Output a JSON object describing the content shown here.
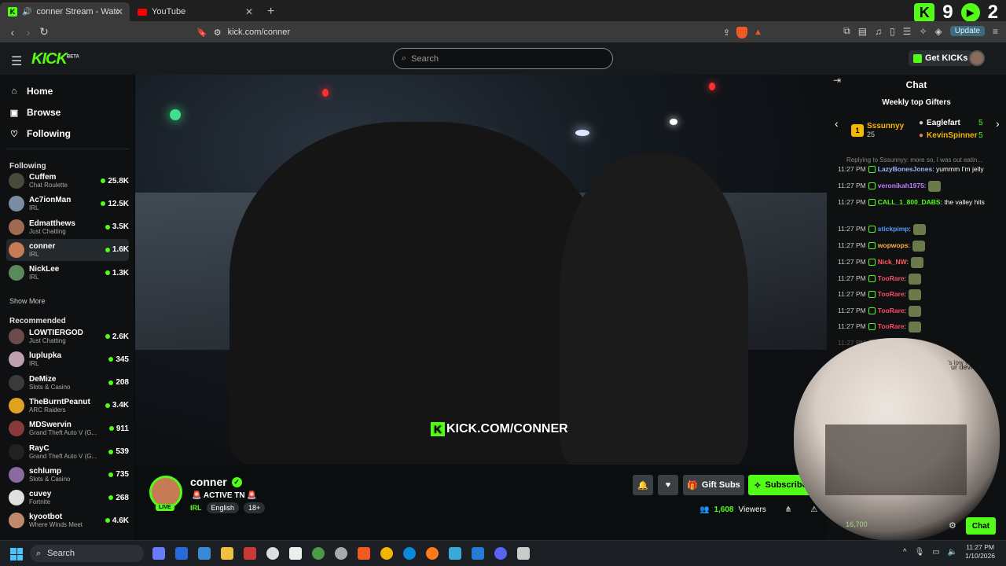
{
  "browser": {
    "tabs": [
      {
        "label": "conner Stream - Watch Live o",
        "active": true
      },
      {
        "label": "YouTube",
        "active": false
      }
    ],
    "badge_k": "9",
    "badge_play": "2",
    "url": "kick.com/conner",
    "update_label": "Update"
  },
  "topnav": {
    "logo": "KICK",
    "logo_sup": "BETA",
    "search_placeholder": "Search",
    "get_kicks": "Get KICKs"
  },
  "sidebar": {
    "nav": [
      "Home",
      "Browse",
      "Following"
    ],
    "following_title": "Following",
    "following": [
      {
        "name": "Cuffem",
        "category": "Chat Roulette",
        "viewers": "25.8K",
        "color": "#4a4a3a"
      },
      {
        "name": "Ac7ionMan",
        "category": "IRL",
        "viewers": "12.5K",
        "color": "#7a8ca0"
      },
      {
        "name": "Edmatthews",
        "category": "Just Chatting",
        "viewers": "3.5K",
        "color": "#a06a50"
      },
      {
        "name": "conner",
        "category": "IRL",
        "viewers": "1.6K",
        "color": "#c77b54"
      },
      {
        "name": "NickLee",
        "category": "IRL",
        "viewers": "1.3K",
        "color": "#5a8a5a"
      }
    ],
    "show_more": "Show More",
    "recommended_title": "Recommended",
    "recommended": [
      {
        "name": "LOWTIERGOD",
        "category": "Just Chatting",
        "viewers": "2.6K",
        "color": "#6a4a4a"
      },
      {
        "name": "luplupka",
        "category": "IRL",
        "viewers": "345",
        "color": "#c0a0b0"
      },
      {
        "name": "DeMize",
        "category": "Slots & Casino",
        "viewers": "208",
        "color": "#3a3a3a"
      },
      {
        "name": "TheBurntPeanut",
        "category": "ARC Raiders",
        "viewers": "3.4K",
        "color": "#e0a020"
      },
      {
        "name": "MDSwervin",
        "category": "Grand Theft Auto V (G...",
        "viewers": "911",
        "color": "#8a3a3a"
      },
      {
        "name": "RayC",
        "category": "Grand Theft Auto V (G...",
        "viewers": "539",
        "color": "#222222"
      },
      {
        "name": "schlump",
        "category": "Slots & Casino",
        "viewers": "735",
        "color": "#8a6aa0"
      },
      {
        "name": "cuvey",
        "category": "Fortnite",
        "viewers": "268",
        "color": "#e0e0e0"
      },
      {
        "name": "kyootbot",
        "category": "Where Winds Meet",
        "viewers": "4.6K",
        "color": "#c08a6a"
      }
    ]
  },
  "video": {
    "watermark": "KICK.COM/CONNER"
  },
  "stream": {
    "name": "conner",
    "live": "LIVE",
    "title": "🚨 ACTIVE TN 🚨",
    "category": "IRL",
    "language": "English",
    "age": "18+",
    "gift_subs": "Gift Subs",
    "subscribe": "Subscribe",
    "viewers": "1,608",
    "viewers_label": "Viewers"
  },
  "chat": {
    "title": "Chat",
    "gifters_title": "Weekly top Gifters",
    "gifters": [
      {
        "name": "Sssunnyy",
        "count": "25",
        "rank": "1"
      },
      {
        "name": "Eaglefart",
        "count": "5"
      },
      {
        "name": "KevinSpinner",
        "count": "5"
      }
    ],
    "reply": "Replying to Sssunnyy: more so, I was out eatin...",
    "messages": [
      {
        "time": "11:27 PM",
        "user": "LazyBonesJones",
        "color": "#9ab8ff",
        "text": ": yummm I'm jelly"
      },
      {
        "time": "11:27 PM",
        "user": "veronikah1975",
        "color": "#c080ff",
        "text": ":"
      },
      {
        "time": "11:27 PM",
        "user": "CALL_1_800_DABS",
        "color": "#53fc18",
        "text": ": the valley hits"
      },
      {
        "time": "11:27 PM",
        "user": "stickpimp",
        "color": "#5a9aff",
        "text": ":"
      },
      {
        "time": "11:27 PM",
        "user": "wopwops",
        "color": "#ffb040",
        "text": ":"
      },
      {
        "time": "11:27 PM",
        "user": "Nick_NW",
        "color": "#ff5a5a",
        "text": ":"
      },
      {
        "time": "11:27 PM",
        "user": "TooRare",
        "color": "#ff4a6a",
        "text": ":"
      },
      {
        "time": "11:27 PM",
        "user": "TooRare",
        "color": "#ff4a6a",
        "text": ":"
      },
      {
        "time": "11:27 PM",
        "user": "TooRare",
        "color": "#ff4a6a",
        "text": ":"
      },
      {
        "time": "11:27 PM",
        "user": "TooRare",
        "color": "#ff4a6a",
        "text": ":"
      },
      {
        "time": "11:27 PM",
        "user": "",
        "color": "#888888",
        "text": ""
      }
    ],
    "overlay_line1": "'s low vol...",
    "overlay_line2": "ur device",
    "cam_viewers": "16,700",
    "chat_button": "Chat"
  },
  "taskbar": {
    "search": "Search",
    "time": "11:27 PM",
    "date": "1/10/2026"
  }
}
